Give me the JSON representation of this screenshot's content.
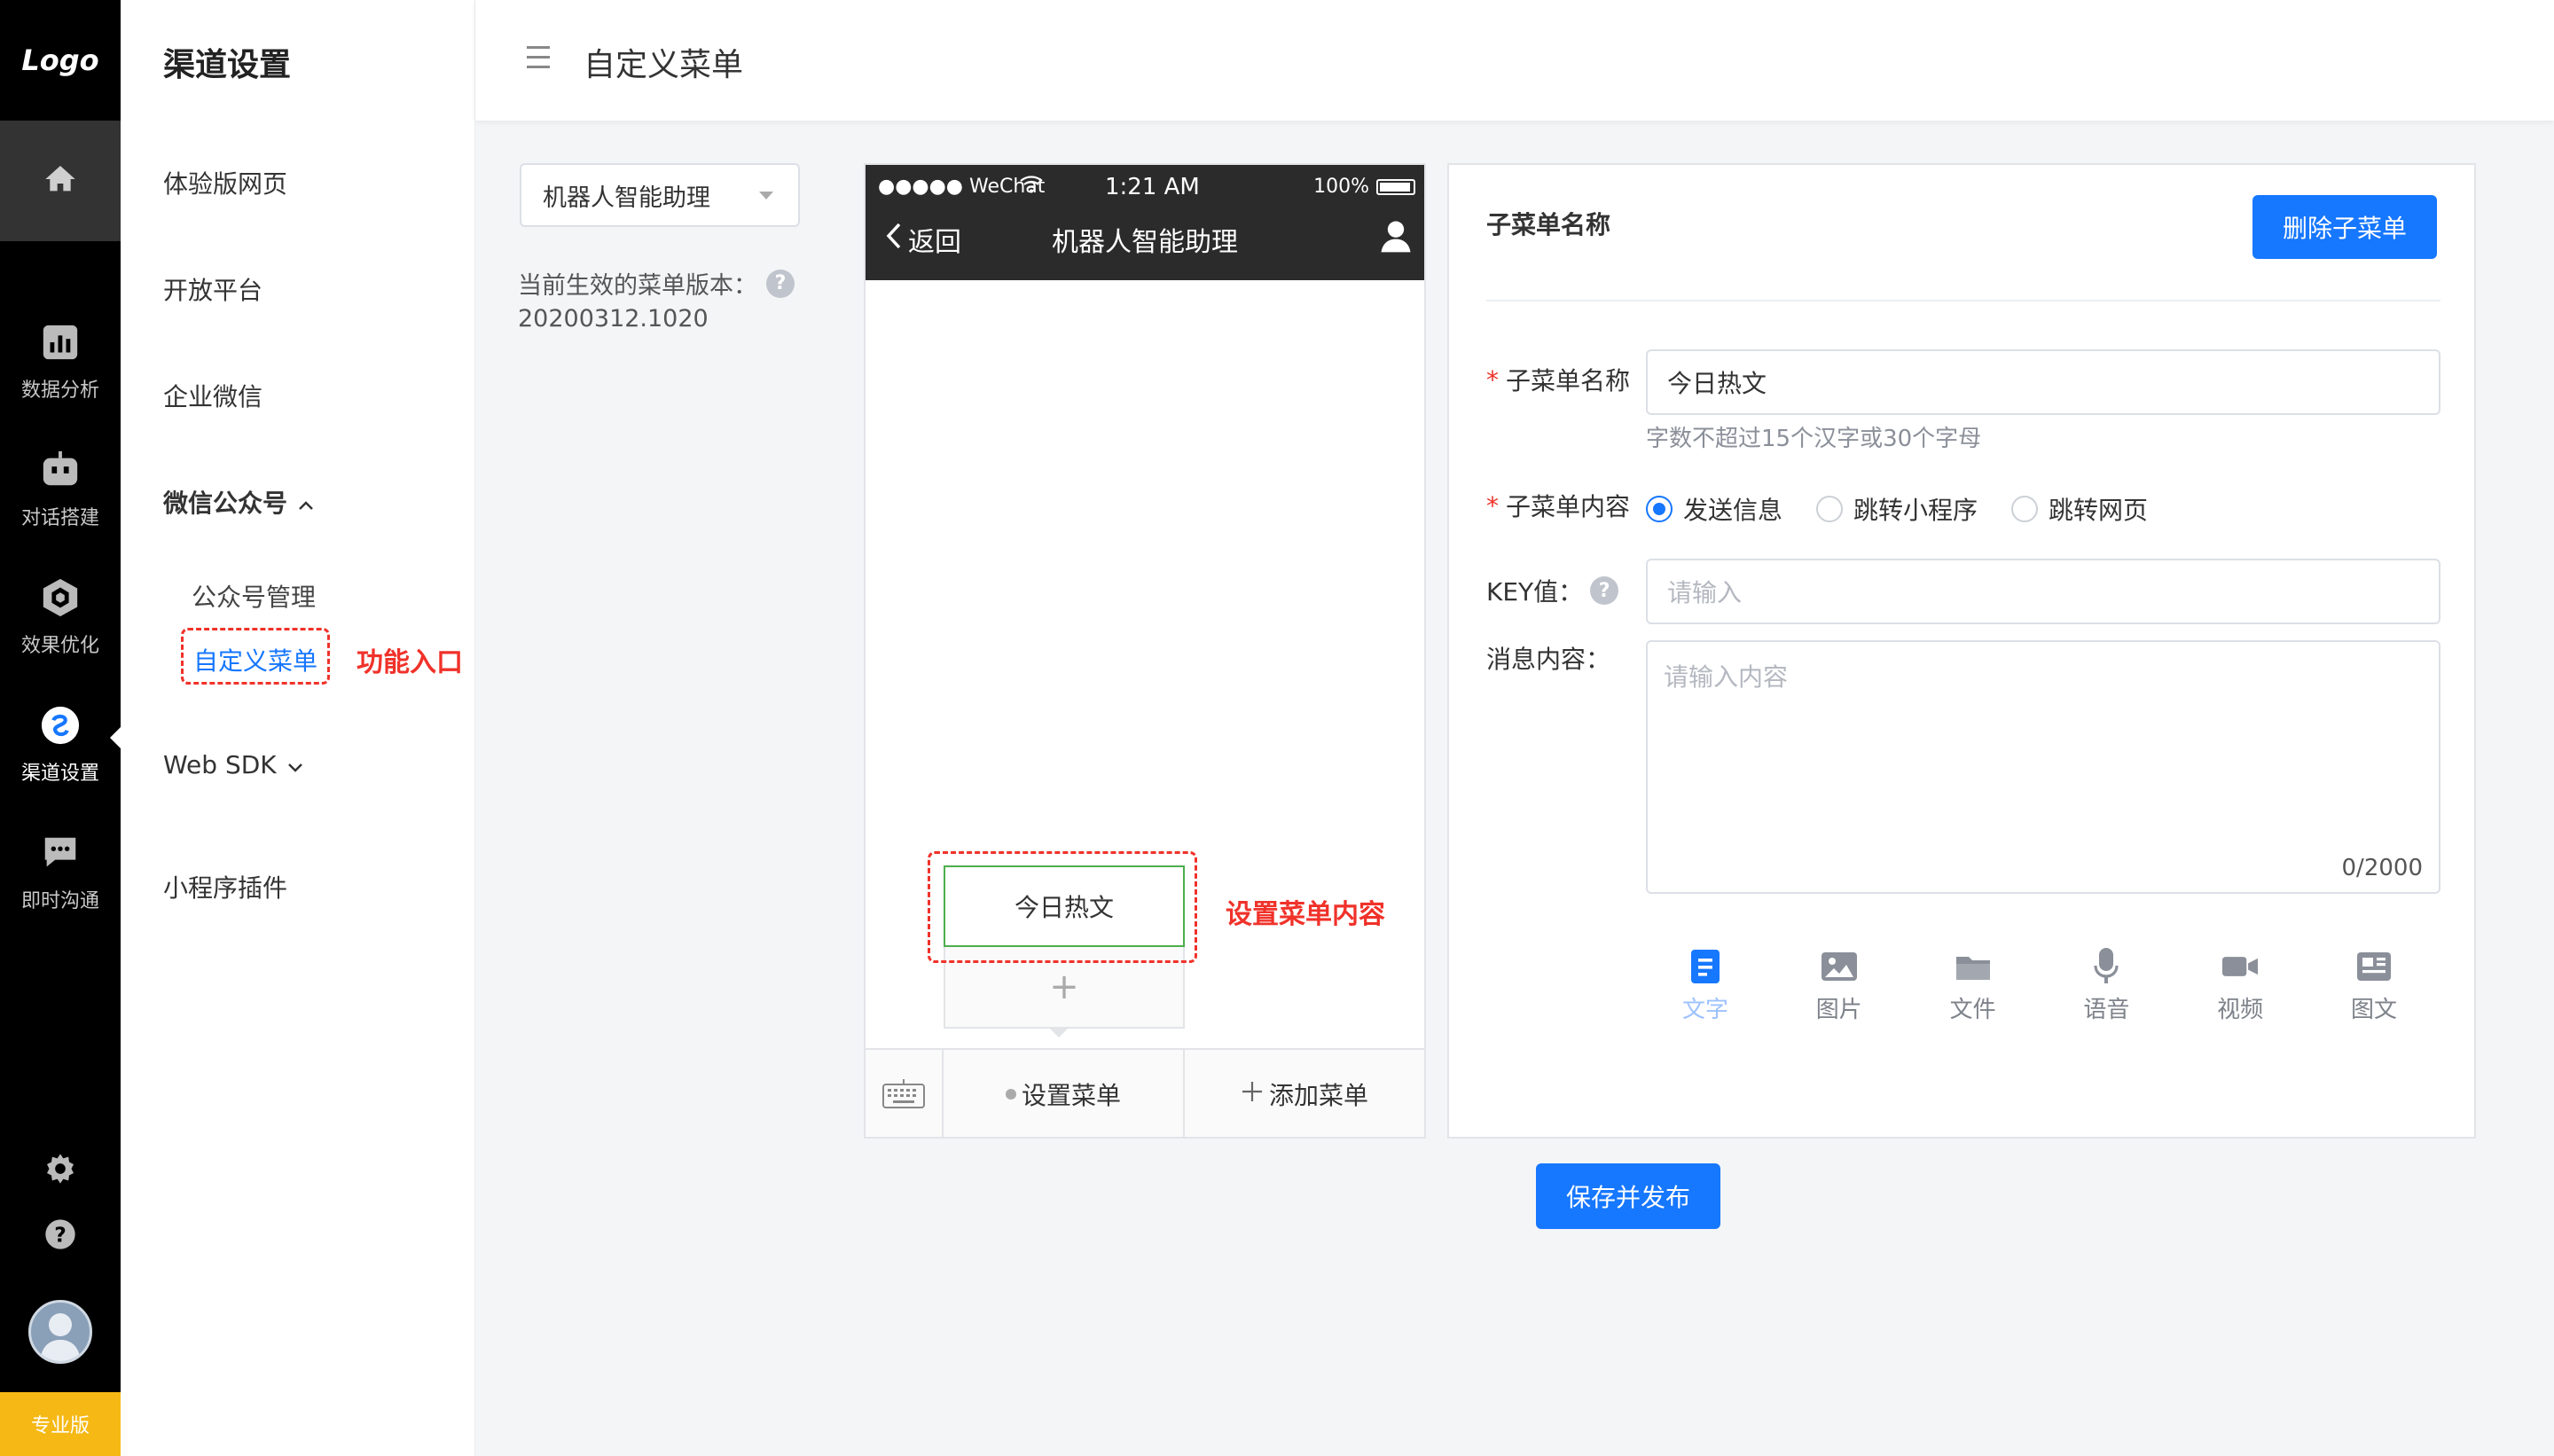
{
  "rail": {
    "logo": "Logo",
    "items": [
      {
        "label": "数据分析",
        "icon": "bar-chart-icon"
      },
      {
        "label": "对话搭建",
        "icon": "robot-icon"
      },
      {
        "label": "效果优化",
        "icon": "cube-icon"
      },
      {
        "label": "渠道设置",
        "icon": "channel-icon"
      },
      {
        "label": "即时沟通",
        "icon": "chat-bubble-icon"
      }
    ],
    "edition": "专业版"
  },
  "subnav": {
    "title": "渠道设置",
    "items": {
      "trial_web": "体验版网页",
      "open_platform": "开放平台",
      "enterprise_wechat": "企业微信",
      "wechat_official": "微信公众号",
      "web_sdk": "Web SDK",
      "mini_program": "小程序插件"
    },
    "children": {
      "account_mgmt": "公众号管理",
      "custom_menu": "自定义菜单"
    },
    "note": "功能入口"
  },
  "header": {
    "title": "自定义菜单"
  },
  "config": {
    "bot_select": "机器人智能助理",
    "version_label": "当前生效的菜单版本：",
    "version_value": "20200312.1020"
  },
  "phone": {
    "carrier": "●●●●● WeChat",
    "time": "1:21 AM",
    "battery": "100%",
    "back": "返回",
    "title": "机器人智能助理",
    "submenu_item": "今日热文",
    "submenu_add": "+",
    "menu1": "设置菜单",
    "menu2": "添加菜单",
    "note": "设置菜单内容"
  },
  "panel": {
    "heading": "子菜单名称",
    "delete_btn": "删除子菜单",
    "name_label": "子菜单名称",
    "name_value": "今日热文",
    "name_hint": "字数不超过15个汉字或30个字母",
    "content_label": "子菜单内容",
    "radios": [
      "发送信息",
      "跳转小程序",
      "跳转网页"
    ],
    "key_label": "KEY值：",
    "key_placeholder": "请输入",
    "msg_label": "消息内容：",
    "msg_placeholder": "请输入内容",
    "counter": "0/2000",
    "tools": [
      {
        "label": "文字",
        "icon": "text-doc-icon"
      },
      {
        "label": "图片",
        "icon": "image-icon"
      },
      {
        "label": "文件",
        "icon": "folder-icon"
      },
      {
        "label": "语音",
        "icon": "microphone-icon"
      },
      {
        "label": "视频",
        "icon": "video-camera-icon"
      },
      {
        "label": "图文",
        "icon": "article-icon"
      }
    ]
  },
  "save_btn": "保存并发布",
  "colors": {
    "primary": "#1677ff",
    "annotation_red": "#f0322a",
    "edition_badge": "#f5b814",
    "rail_bg": "#000000"
  }
}
